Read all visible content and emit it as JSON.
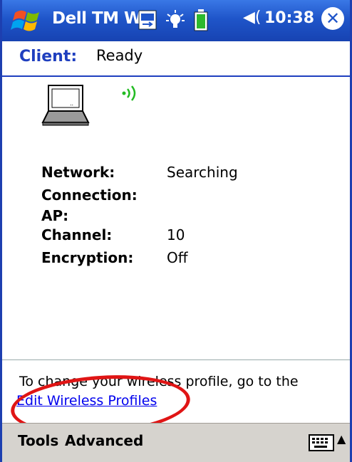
{
  "titlebar": {
    "title": "Dell TM W",
    "time": "10:38",
    "start_icon": "windows-flag-icon",
    "close_symbol": "✕"
  },
  "client": {
    "label": "Client:",
    "status": "Ready"
  },
  "info": {
    "rows": [
      {
        "label": "Network:",
        "value": "Searching"
      },
      {
        "label": "Connection:",
        "value": ""
      },
      {
        "label": "AP:",
        "value": ""
      },
      {
        "label": "Channel:",
        "value": "10"
      },
      {
        "label": "Encryption:",
        "value": "Off"
      }
    ]
  },
  "footer": {
    "hint": "To change your wireless profile, go to the",
    "link": "Edit Wireless Profiles"
  },
  "menubar": {
    "tools": "Tools",
    "advanced": "Advanced"
  },
  "colors": {
    "titlebar": "#1f55c9",
    "accent": "#1f3fbf",
    "link": "#0000ee",
    "annotation": "#e01515"
  }
}
